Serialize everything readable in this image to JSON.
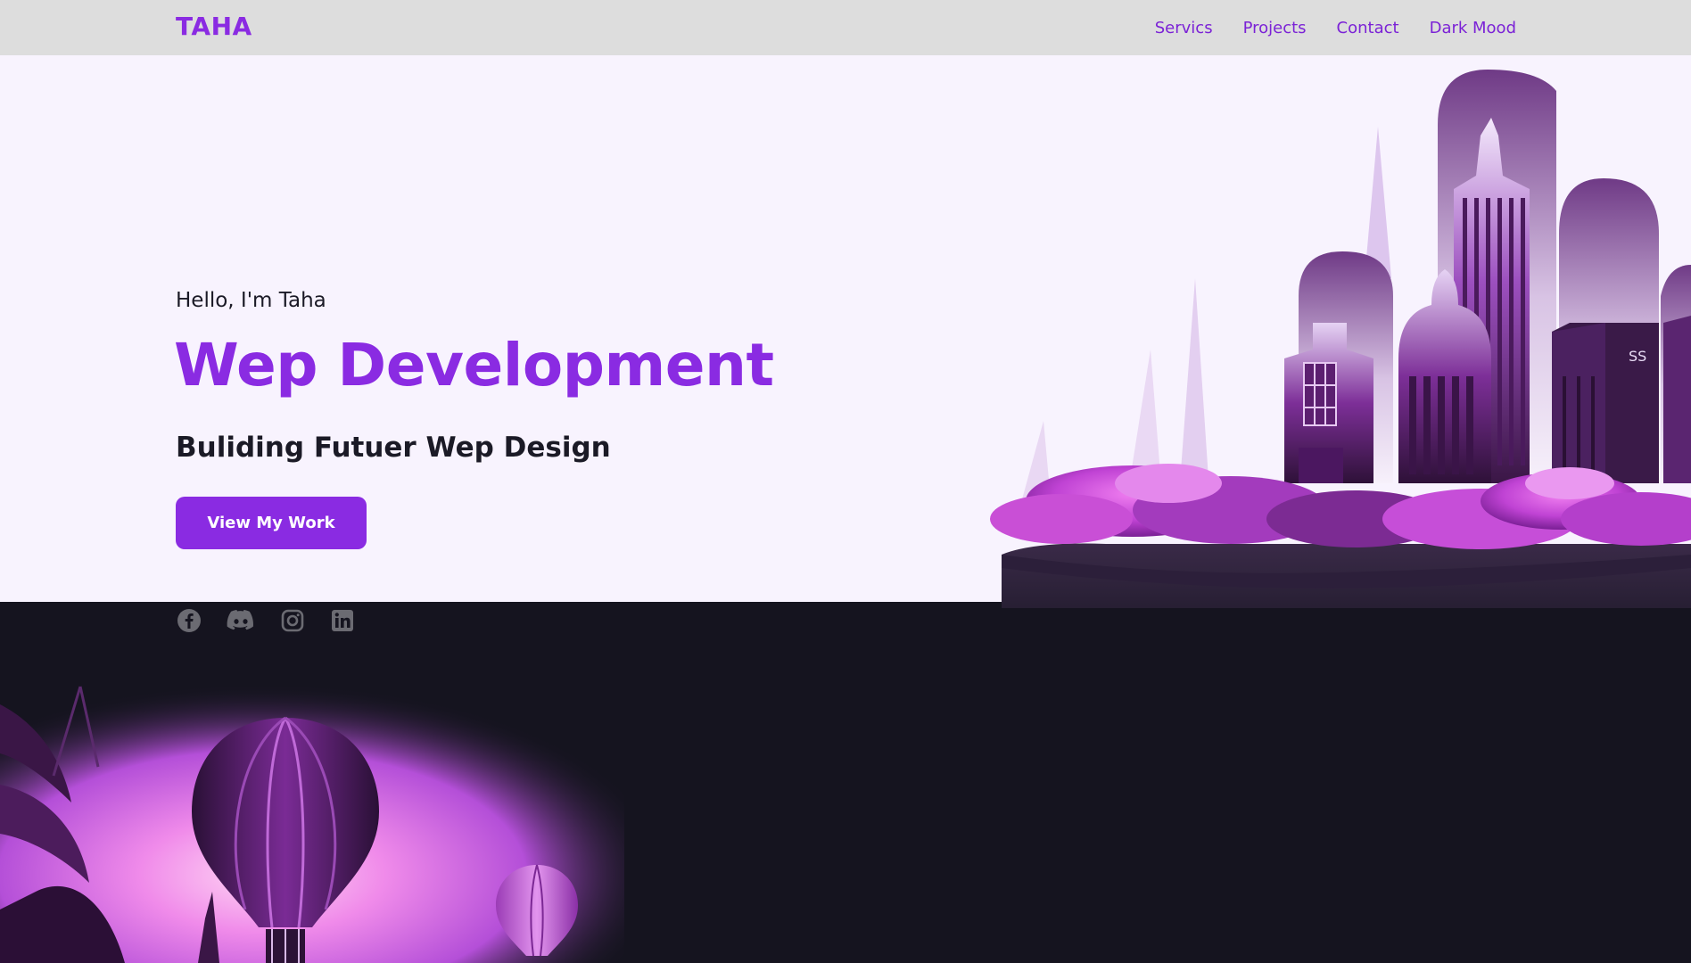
{
  "nav": {
    "logo": "TAHA",
    "links": [
      "Servics",
      "Projects",
      "Contact",
      "Dark Mood"
    ]
  },
  "hero": {
    "greeting": "Hello, I'm Taha",
    "title": "Wep Development",
    "subtitle": "Buliding Futuer Wep Design",
    "cta_label": "View My Work",
    "image_label": "SS"
  },
  "social": {
    "icons": [
      "facebook-icon",
      "discord-icon",
      "instagram-icon",
      "linkedin-icon"
    ]
  },
  "colors": {
    "accent": "#8a2be2",
    "nav_bg": "#dddddd",
    "hero_bg": "#f8f3fe",
    "dark_bg": "#15141f",
    "text_dark": "#1b1a26",
    "icon_gray": "#6b6b72"
  }
}
